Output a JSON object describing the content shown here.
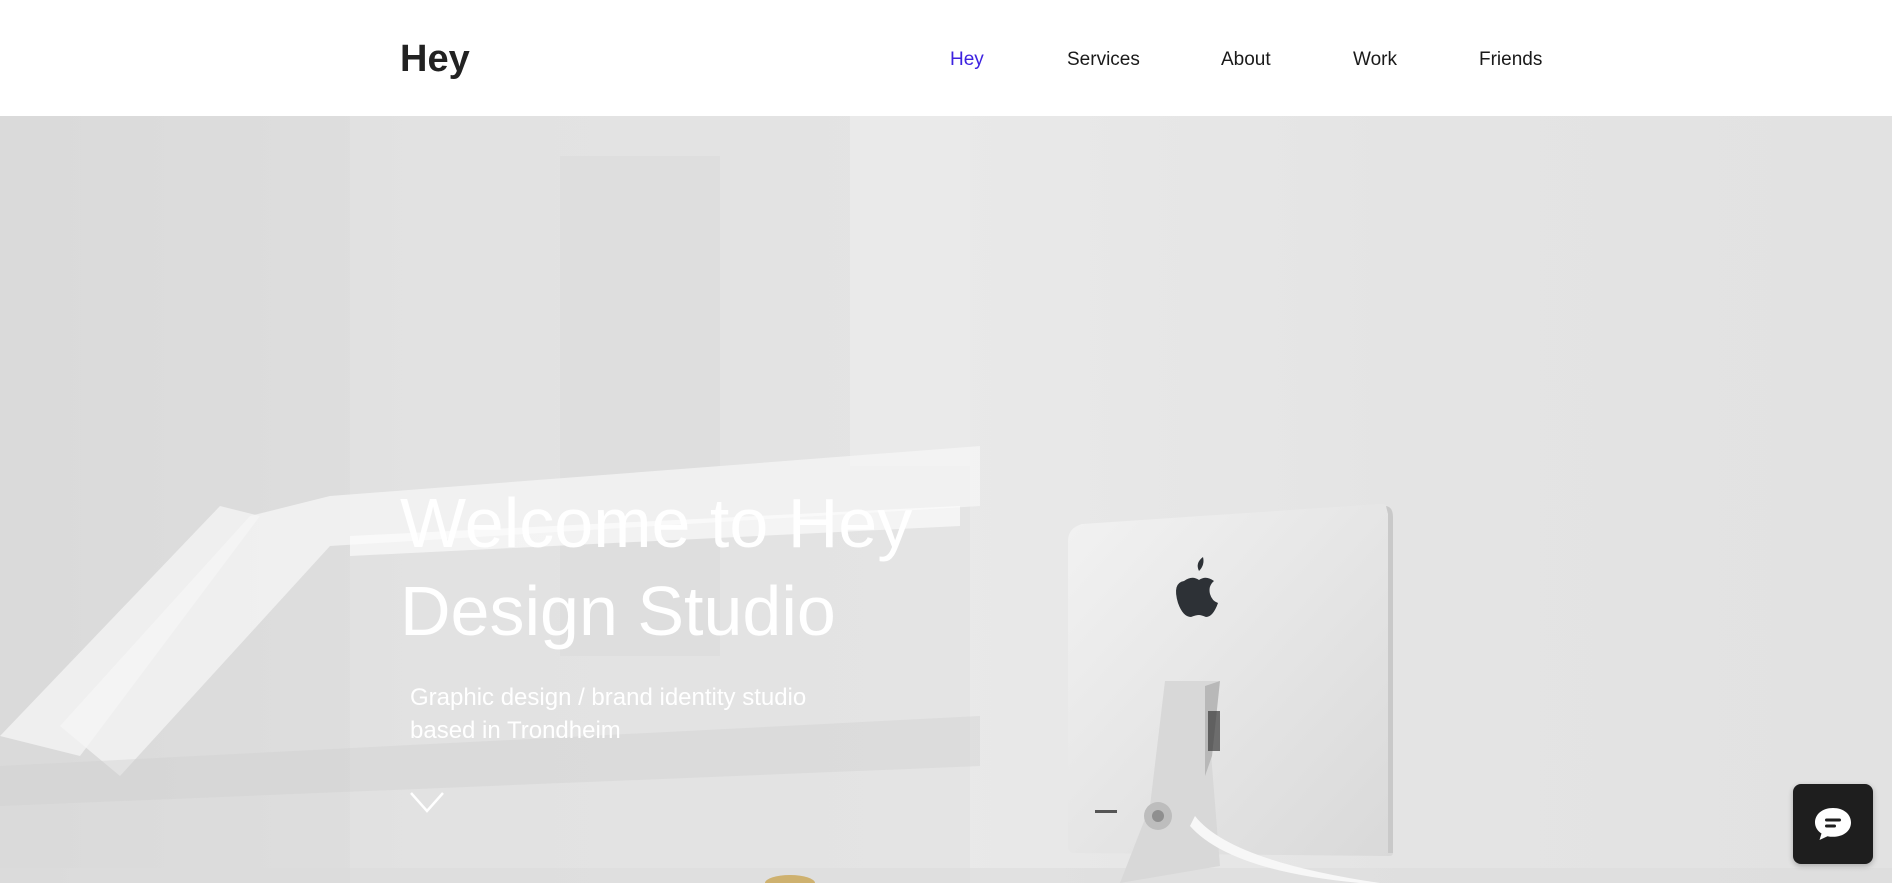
{
  "header": {
    "logo": "Hey",
    "nav": [
      {
        "label": "Hey",
        "active": true
      },
      {
        "label": "Services",
        "active": false
      },
      {
        "label": "About",
        "active": false
      },
      {
        "label": "Work",
        "active": false
      },
      {
        "label": "Friends",
        "active": false
      }
    ]
  },
  "hero": {
    "title_line1": "Welcome to Hey",
    "title_line2": "Design Studio",
    "subtitle_line1": "Graphic design / brand identity studio",
    "subtitle_line2": "based in Trondheim",
    "scroll_icon": "chevron-down-icon"
  },
  "chat": {
    "icon": "chat-bubble-icon"
  },
  "colors": {
    "nav_active": "#3d22e0",
    "nav_text": "#1a1a1a",
    "logo": "#222222",
    "chat_bg": "#1e1e1e"
  }
}
